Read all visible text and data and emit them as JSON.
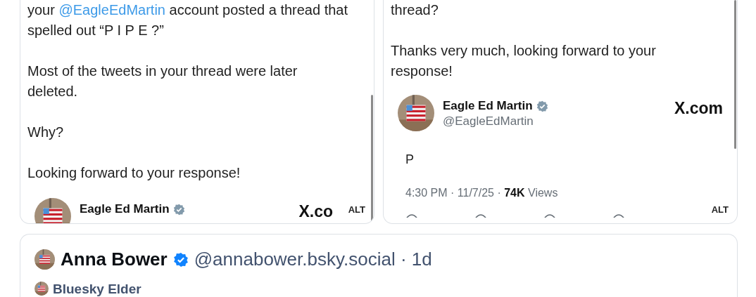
{
  "attachments": [
    {
      "paragraphs": [
        [
          {
            "text": "your "
          },
          {
            "text": "@EagleEdMartin",
            "kind": "link"
          },
          {
            "text": " account posted a thread that"
          },
          {
            "kind": "break"
          },
          {
            "text": "spelled out “P I P E ?”"
          }
        ],
        [
          {
            "text": "Most of the tweets in your thread were later"
          },
          {
            "kind": "break"
          },
          {
            "text": "deleted."
          }
        ],
        [
          {
            "text": "Why?"
          }
        ],
        [
          {
            "text": "Looking forward to your response!"
          }
        ]
      ],
      "tweet": {
        "name": "Eagle Ed Martin",
        "verified": true,
        "brand": "X.co"
      },
      "alt": "ALT"
    },
    {
      "paragraphs": [
        [
          {
            "text": "thread?"
          }
        ],
        [
          {
            "text": "Thanks very much, looking forward to your"
          },
          {
            "kind": "break"
          },
          {
            "text": "response!"
          }
        ]
      ],
      "tweet": {
        "name": "Eagle Ed Martin",
        "verified": true,
        "handle": "@EagleEdMartin",
        "brand": "X.com",
        "text": "P",
        "meta": "4:30 PM · 11/7/25 · **74K** Views"
      },
      "alt": "ALT"
    }
  ],
  "post": {
    "name": "Anna Bower",
    "verified": true,
    "handle": "@annabower.bsky.social · 1d",
    "reposter": "Bluesky Elder"
  }
}
